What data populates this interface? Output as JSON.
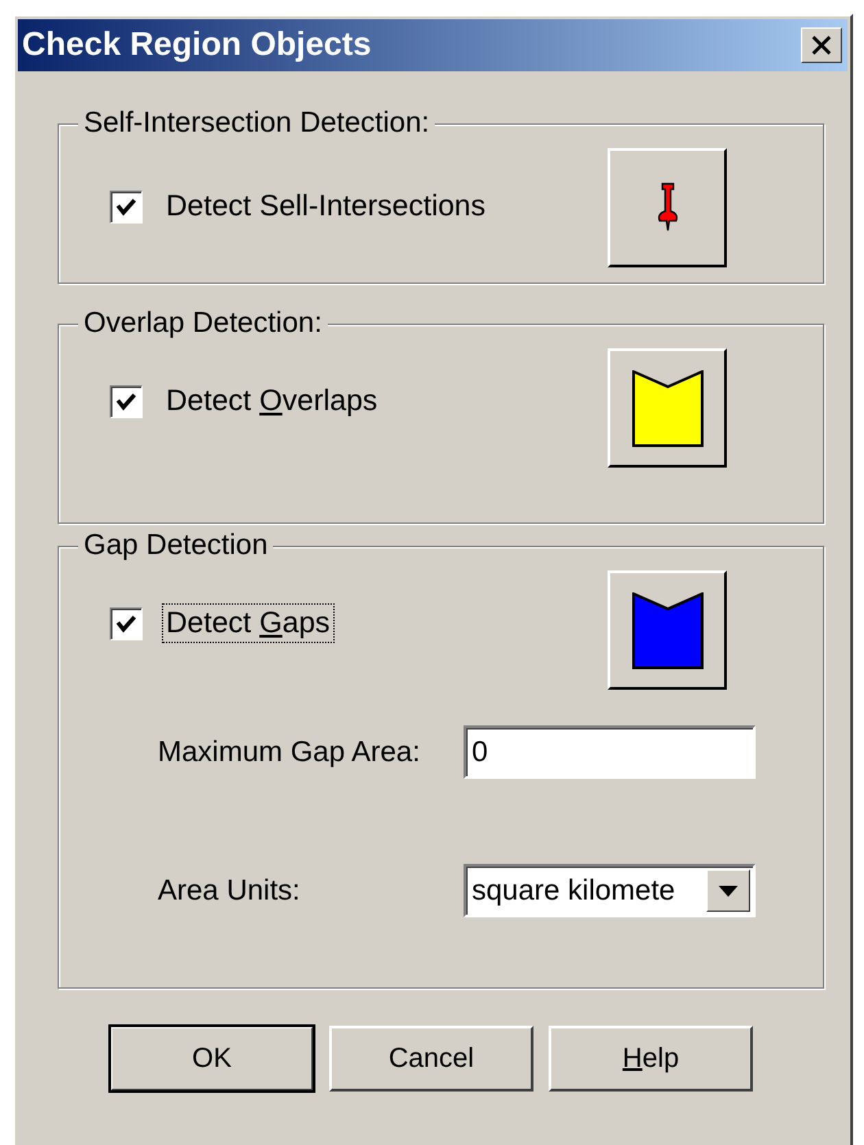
{
  "window": {
    "title": "Check Region Objects"
  },
  "groups": [
    {
      "title": "Self-Intersection Detection:",
      "checkbox": {
        "label": [
          {
            "text": "Detect Sell-Intersections",
            "underline": false
          }
        ],
        "checked": true,
        "focused": false
      },
      "icon": {
        "kind": "pin",
        "color": "#ff0000"
      }
    },
    {
      "title": "Overlap Detection:",
      "checkbox": {
        "label": [
          {
            "text": "Detect ",
            "underline": false
          },
          {
            "text": "O",
            "underline": true
          },
          {
            "text": "verlaps",
            "underline": false
          }
        ],
        "checked": true,
        "focused": false
      },
      "icon": {
        "kind": "banner",
        "color": "#ffff00"
      }
    },
    {
      "title": "Gap Detection",
      "checkbox": {
        "label": [
          {
            "text": "Detect ",
            "underline": false
          },
          {
            "text": "G",
            "underline": true
          },
          {
            "text": "aps",
            "underline": false
          }
        ],
        "checked": true,
        "focused": true
      },
      "icon": {
        "kind": "banner",
        "color": "#0000ff"
      },
      "fields": [
        {
          "kind": "text",
          "label": "Maximum Gap Area:",
          "value": "0"
        },
        {
          "kind": "dropdown",
          "label": "Area Units:",
          "value": "square kilomete"
        }
      ]
    }
  ],
  "buttons": [
    {
      "label": [
        {
          "text": "OK",
          "underline": false
        }
      ],
      "default": true
    },
    {
      "label": [
        {
          "text": "Cancel",
          "underline": false
        }
      ],
      "default": false
    },
    {
      "label": [
        {
          "text": "H",
          "underline": true
        },
        {
          "text": "elp",
          "underline": false
        }
      ],
      "default": false
    }
  ]
}
